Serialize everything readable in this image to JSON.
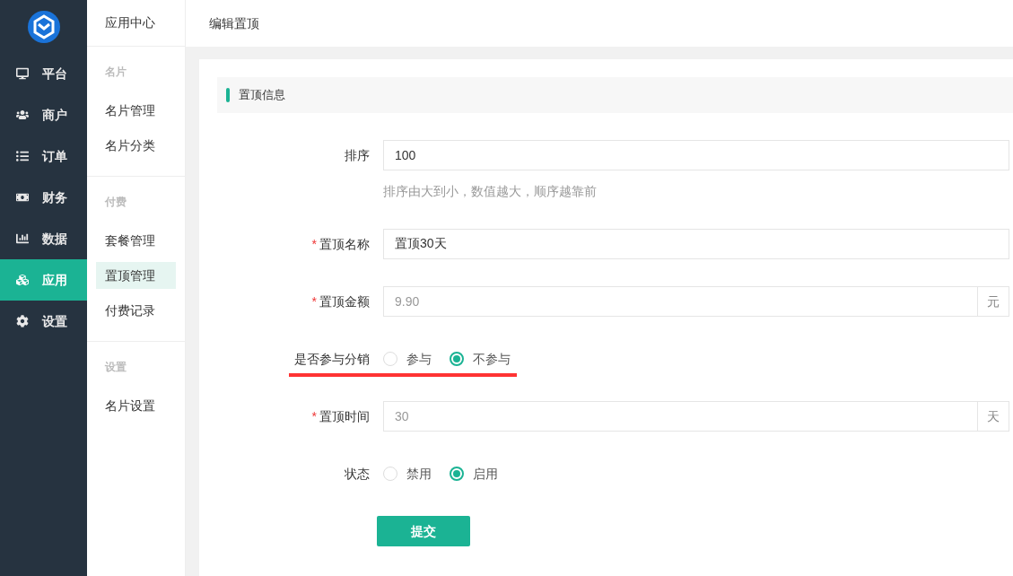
{
  "sidebar": {
    "items": [
      {
        "label": "平台",
        "selected": false
      },
      {
        "label": "商户",
        "selected": false
      },
      {
        "label": "订单",
        "selected": false
      },
      {
        "label": "财务",
        "selected": false
      },
      {
        "label": "数据",
        "selected": false
      },
      {
        "label": "应用",
        "selected": true
      },
      {
        "label": "设置",
        "selected": false
      }
    ]
  },
  "subnav": {
    "title": "应用中心",
    "groups": [
      {
        "title": "名片",
        "items": [
          {
            "label": "名片管理",
            "selected": false
          },
          {
            "label": "名片分类",
            "selected": false
          }
        ]
      },
      {
        "title": "付费",
        "items": [
          {
            "label": "套餐管理",
            "selected": false
          },
          {
            "label": "置顶管理",
            "selected": true
          },
          {
            "label": "付费记录",
            "selected": false
          }
        ]
      },
      {
        "title": "设置",
        "items": [
          {
            "label": "名片设置",
            "selected": false
          }
        ]
      }
    ]
  },
  "header": {
    "title": "编辑置顶"
  },
  "section_title": "置顶信息",
  "form": {
    "fields": [
      {
        "kind": "input",
        "label": "排序",
        "value": "100",
        "hint": "排序由大到小，数值越大，顺序越靠前"
      },
      {
        "kind": "input",
        "label": "置顶名称",
        "required_mark": "*",
        "value": "置顶30天"
      },
      {
        "kind": "input",
        "label": "置顶金额",
        "required_mark": "*",
        "placeholder": "9.90",
        "suffix": "元"
      },
      {
        "kind": "radio",
        "label": "是否参与分销",
        "underlined": true,
        "options": [
          {
            "label": "参与",
            "selected": false
          },
          {
            "label": "不参与",
            "selected": true
          }
        ]
      },
      {
        "kind": "input",
        "label": "置顶时间",
        "required_mark": "*",
        "placeholder": "30",
        "suffix": "天"
      },
      {
        "kind": "radio",
        "label": "状态",
        "options": [
          {
            "label": "禁用",
            "selected": false
          },
          {
            "label": "启用",
            "selected": true
          }
        ]
      }
    ],
    "submit": "提交"
  }
}
